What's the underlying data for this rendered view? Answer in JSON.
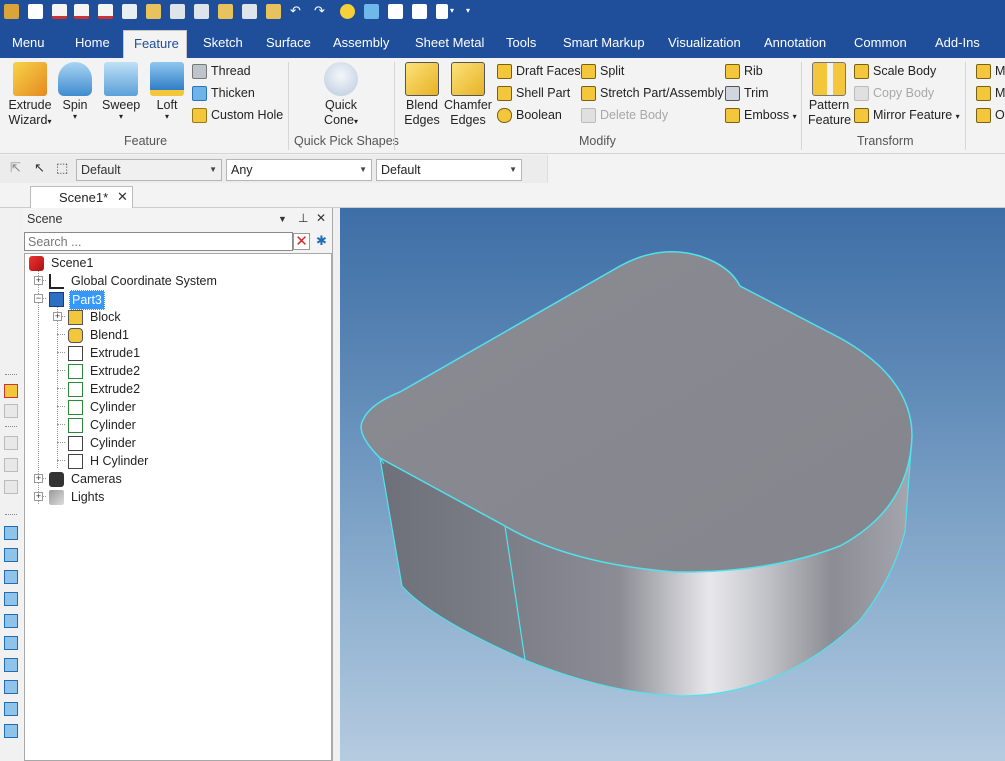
{
  "tabs": [
    "Menu",
    "Home",
    "Feature",
    "Sketch",
    "Surface",
    "Assembly",
    "Sheet Metal",
    "Tools",
    "Smart Markup",
    "Visualization",
    "Annotation",
    "Common",
    "Add-Ins"
  ],
  "active_tab": "Feature",
  "ribbon": {
    "feature_group": {
      "label": "Feature",
      "extrude_wizard": "Extrude Wizard",
      "extrude_l1": "Extrude",
      "extrude_l2": "Wizard",
      "spin": "Spin",
      "sweep": "Sweep",
      "loft": "Loft",
      "thread": "Thread",
      "thicken": "Thicken",
      "custom_hole": "Custom Hole"
    },
    "quick_pick": {
      "label": "Quick Pick Shapes",
      "quick_l1": "Quick",
      "quick_l2": "Cone"
    },
    "modify": {
      "label": "Modify",
      "blend_l1": "Blend",
      "blend_l2": "Edges",
      "chamfer_l1": "Chamfer",
      "chamfer_l2": "Edges",
      "draft_faces": "Draft Faces",
      "shell_part": "Shell Part",
      "boolean": "Boolean",
      "split": "Split",
      "stretch": "Stretch Part/Assembly",
      "delete_body": "Delete Body",
      "rib": "Rib",
      "trim": "Trim",
      "emboss": "Emboss"
    },
    "transform": {
      "label": "Transform",
      "pattern_l1": "Pattern",
      "pattern_l2": "Feature",
      "scale_body": "Scale Body",
      "copy_body": "Copy Body",
      "mirror_feature": "Mirror Feature"
    },
    "overflow": [
      "M",
      "M",
      "Ot"
    ]
  },
  "selection_toolbar": {
    "combo1": "Default",
    "combo2": "Any",
    "combo3": "Default"
  },
  "document_tab": {
    "label": "Scene1*"
  },
  "scene_panel": {
    "title": "Scene",
    "search_placeholder": "Search ...",
    "tree": {
      "root": "Scene1",
      "gcs": "Global Coordinate System",
      "part": "Part3",
      "children": [
        "Block",
        "Blend1",
        "Extrude1",
        "Extrude2",
        "Extrude2",
        "Cylinder",
        "Cylinder",
        "Cylinder",
        "H Cylinder"
      ],
      "cameras": "Cameras",
      "lights": "Lights"
    }
  },
  "colors": {
    "brand_blue": "#1f4e9a",
    "selection_blue": "#3399ff",
    "edge_highlight": "#4fe3ef"
  }
}
